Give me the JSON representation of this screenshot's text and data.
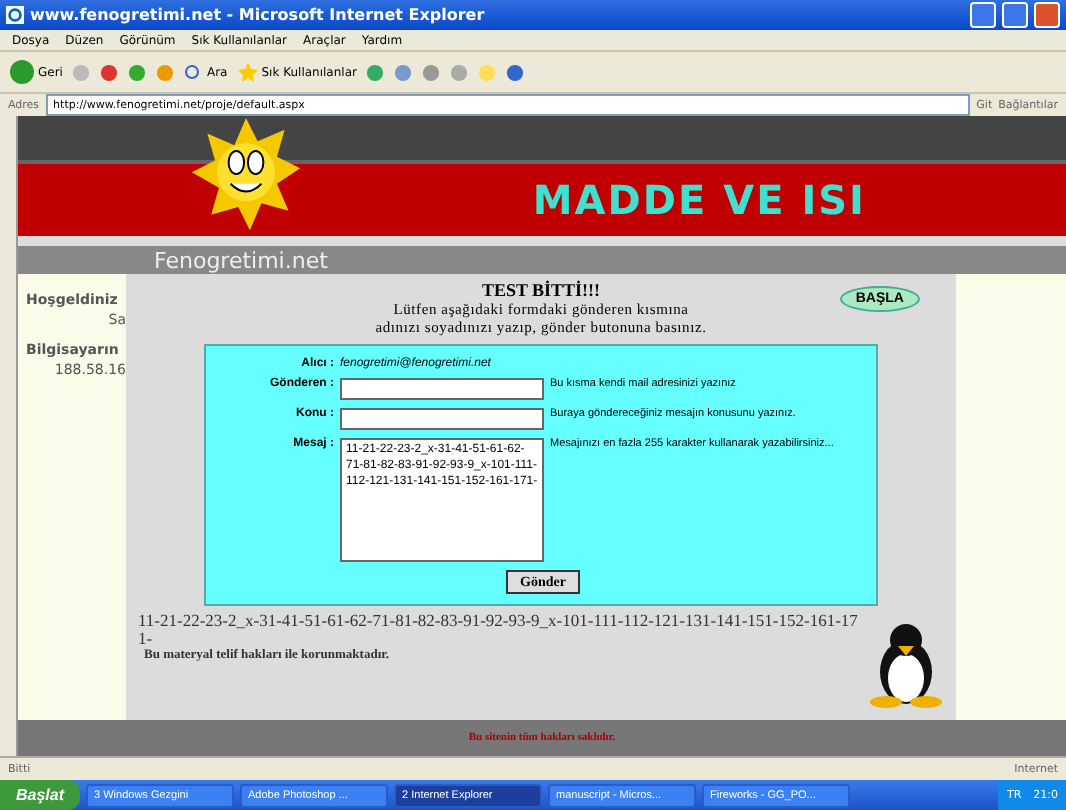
{
  "window": {
    "title": "www.fenogretimi.net - Microsoft Internet Explorer"
  },
  "menu": [
    "Dosya",
    "Düzen",
    "Görünüm",
    "Sık Kullanılanlar",
    "Araçlar",
    "Yardım"
  ],
  "toolbar": {
    "back": "Geri",
    "search": "Ara",
    "favorites": "Sık Kullanılanlar"
  },
  "address": {
    "label": "Adres",
    "url": "http://www.fenogretimi.net/proje/default.aspx",
    "go": "Git",
    "links": "Bağlantılar"
  },
  "banner": {
    "title": "MADDE VE ISI",
    "site": "Fenogretimi.net"
  },
  "sidebar": {
    "items": [
      "Hoşgeldiniz",
      "Sa",
      "Bilgisayarın",
      "188.58.16"
    ]
  },
  "content": {
    "heading": "TEST BİTTİ!!!",
    "instruction": "Lütfen aşağıdaki formdaki gönderen kısmına",
    "instruction_2": "adınızı soyadınızı yazıp, gönder butonuna basınız.",
    "start_button": "BAŞLA",
    "form": {
      "to_label": "Alıcı :",
      "to_value": "fenogretimi@fenogretimi.net",
      "fields": [
        {
          "kind": "input",
          "label": "Gönderen :",
          "hint": "Bu kısma kendi mail adresinizi yazınız"
        },
        {
          "kind": "input",
          "label": "Konu :",
          "hint": "Buraya göndereceğiniz mesajın konusunu yazınız."
        },
        {
          "kind": "textarea",
          "label": "Mesaj :",
          "value": "11-21-22-23-2_x-31-41-51-61-62-71-81-82-83-91-92-93-9_x-101-111-112-121-131-141-151-152-161-171-",
          "hint": "Mesajınızı en fazla 255 karakter kullanarak yazabilirsiniz..."
        }
      ],
      "submit": "Gönder"
    },
    "result": "11-21-22-23-2_x-31-41-51-61-62-71-81-82-83-91-92-93-9_x-101-111-112-121-131-141-151-152-161-171-",
    "copyright": "Bu materyal telif hakları ile korunmaktadır."
  },
  "footer": "Bu sitenin tüm hakları saklıdır.",
  "status_bar": {
    "status": "Bitti",
    "zone": "Internet"
  },
  "taskbar": {
    "start": "Başlat",
    "items": [
      {
        "label": "3 Windows Gezgini",
        "selected": false
      },
      {
        "label": "Adobe Photoshop ...",
        "selected": false
      },
      {
        "label": "2 Internet Explorer",
        "selected": true
      },
      {
        "label": "manuscript - Micros...",
        "selected": false
      },
      {
        "label": "Fireworks - GG_PO...",
        "selected": false
      }
    ],
    "lang": "TR",
    "clock": "21:0"
  }
}
